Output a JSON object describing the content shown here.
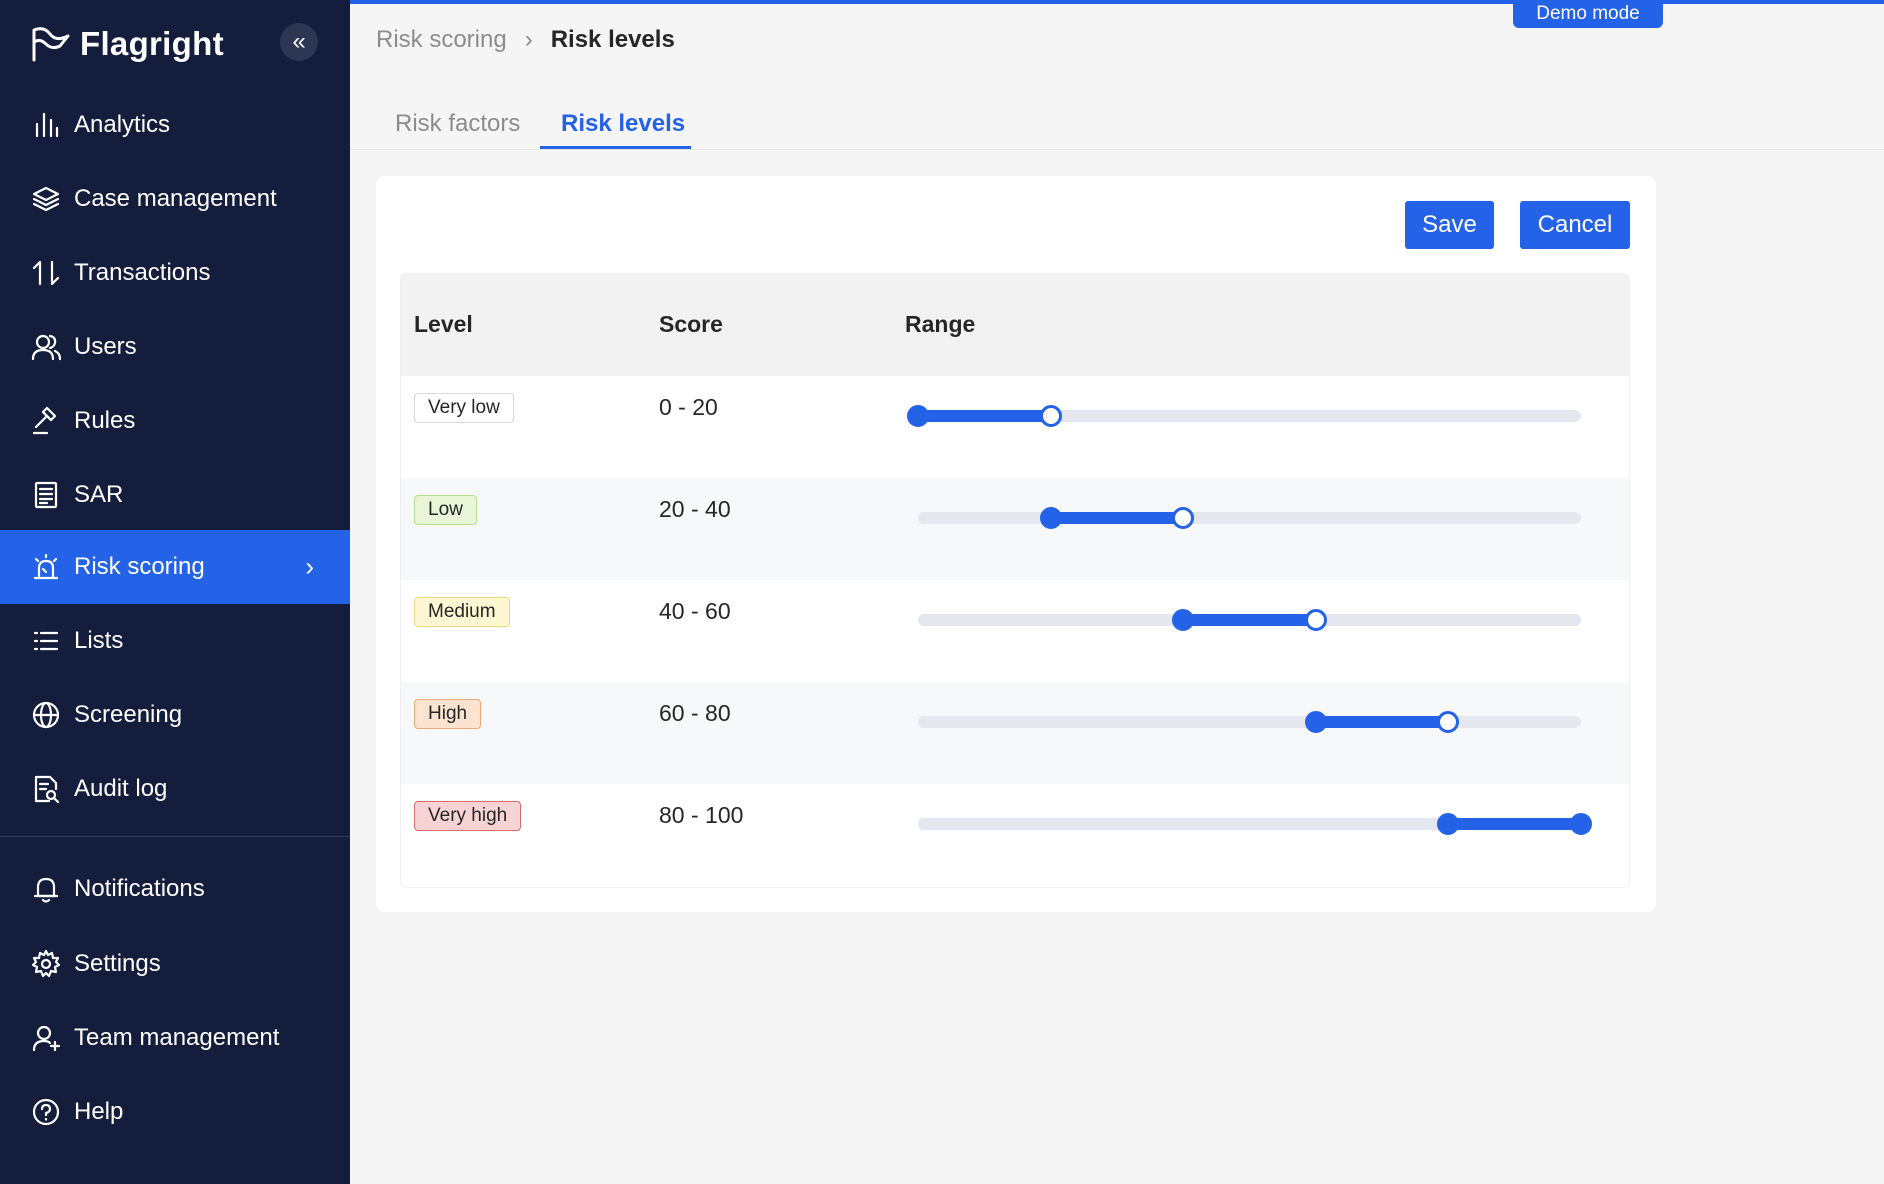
{
  "app": {
    "name": "Flagright",
    "demo_badge": "Demo mode"
  },
  "sidebar": {
    "items": [
      {
        "label": "Analytics",
        "icon": "bar-chart-icon"
      },
      {
        "label": "Case management",
        "icon": "layers-icon"
      },
      {
        "label": "Transactions",
        "icon": "arrows-updown-icon"
      },
      {
        "label": "Users",
        "icon": "users-icon"
      },
      {
        "label": "Rules",
        "icon": "gavel-icon"
      },
      {
        "label": "SAR",
        "icon": "document-icon"
      },
      {
        "label": "Risk scoring",
        "icon": "alarm-icon",
        "active": true
      },
      {
        "label": "Lists",
        "icon": "list-icon"
      },
      {
        "label": "Screening",
        "icon": "globe-icon"
      },
      {
        "label": "Audit log",
        "icon": "audit-doc-icon"
      }
    ],
    "bottom_items": [
      {
        "label": "Notifications",
        "icon": "bell-icon"
      },
      {
        "label": "Settings",
        "icon": "gear-icon"
      },
      {
        "label": "Team management",
        "icon": "team-icon"
      },
      {
        "label": "Help",
        "icon": "help-circle-icon"
      }
    ]
  },
  "breadcrumb": {
    "parent": "Risk scoring",
    "current": "Risk levels"
  },
  "tabs": [
    {
      "label": "Risk factors"
    },
    {
      "label": "Risk levels",
      "active": true
    }
  ],
  "actions": {
    "save": "Save",
    "cancel": "Cancel"
  },
  "table": {
    "columns": [
      "Level",
      "Score",
      "Range"
    ],
    "scale": {
      "min": 0,
      "max": 100
    },
    "rows": [
      {
        "level": "Very low",
        "score": "0 - 20",
        "low": 0,
        "high": 20,
        "tag_bg": "#ffffff",
        "tag_border": "#d9d9d9",
        "tag_color": "#262626"
      },
      {
        "level": "Low",
        "score": "20 - 40",
        "low": 20,
        "high": 40,
        "tag_bg": "#e8f5d6",
        "tag_border": "#b7e08a",
        "tag_color": "#262626"
      },
      {
        "level": "Medium",
        "score": "40 - 60",
        "low": 40,
        "high": 60,
        "tag_bg": "#fdf6d2",
        "tag_border": "#f0d97a",
        "tag_color": "#262626"
      },
      {
        "level": "High",
        "score": "60 - 80",
        "low": 60,
        "high": 80,
        "tag_bg": "#fbe3cf",
        "tag_border": "#e8a87a",
        "tag_color": "#262626"
      },
      {
        "level": "Very high",
        "score": "80 - 100",
        "low": 80,
        "high": 100,
        "tag_bg": "#f8d3d3",
        "tag_border": "#d96b6b",
        "tag_color": "#262626"
      }
    ]
  },
  "colors": {
    "accent": "#2462e8",
    "sidebar_bg": "#141e3c"
  }
}
